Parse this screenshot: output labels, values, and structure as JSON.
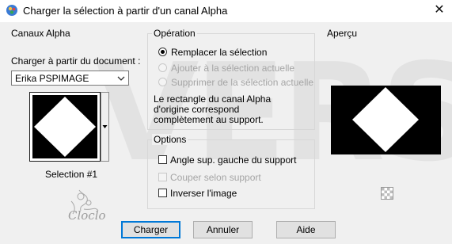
{
  "window": {
    "title": "Charger la sélection à partir d'un canal Alpha",
    "close_glyph": "✕"
  },
  "watermark": {
    "text": "VERS"
  },
  "channels": {
    "group_title": "Canaux Alpha",
    "load_from_label": "Charger à partir du document :",
    "document_select": {
      "value": "Erika PSPIMAGE"
    },
    "selection_caption": "Selection #1"
  },
  "operation": {
    "group_title": "Opération",
    "options": [
      {
        "label": "Remplacer la sélection",
        "selected": true,
        "enabled": true
      },
      {
        "label": "Ajouter à la sélection actuelle",
        "selected": false,
        "enabled": false
      },
      {
        "label": "Supprimer de la sélection actuelle",
        "selected": false,
        "enabled": false
      }
    ],
    "note_line1": "Le rectangle du canal Alpha",
    "note_line2": "d'origine correspond",
    "note_line3": "complètement au support."
  },
  "options": {
    "group_title": "Options",
    "checkboxes": [
      {
        "label": "Angle sup. gauche du support",
        "checked": false,
        "enabled": true
      },
      {
        "label": "Couper selon support",
        "checked": false,
        "enabled": false
      },
      {
        "label": "Inverser l'image",
        "checked": false,
        "enabled": true
      }
    ]
  },
  "preview": {
    "group_title": "Aperçu"
  },
  "buttons": {
    "load": "Charger",
    "cancel": "Annuler",
    "help": "Aide"
  },
  "logo": {
    "text": "Cloclo"
  },
  "colors": {
    "accent": "#0078d7",
    "dialog_bg": "#f0f0f0",
    "preview_bg": "#000000",
    "selection_fill": "#ffffff"
  }
}
